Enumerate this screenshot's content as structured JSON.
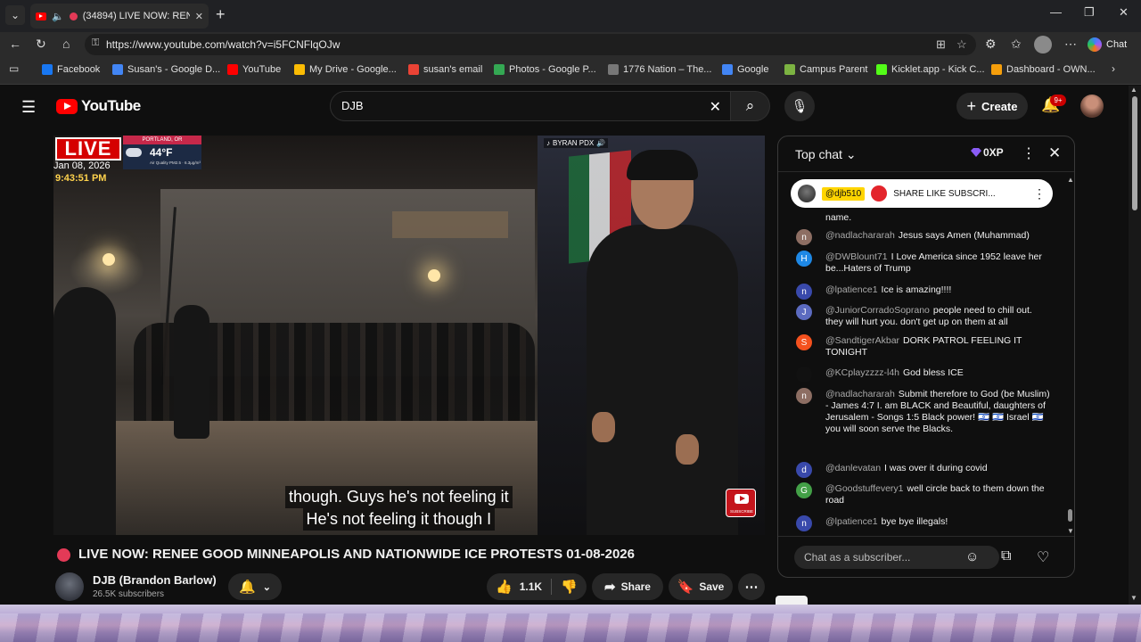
{
  "browser": {
    "tab": {
      "title": "(34894) LIVE NOW: RENEE GOOD MINNEAPOLIS",
      "close": "✕"
    },
    "new_tab": "+",
    "url": "https://www.youtube.com/watch?v=i5FCNFlqOJw",
    "chat_label": "Chat",
    "bookmarks": [
      {
        "label": "Facebook",
        "color": "#1877f2"
      },
      {
        "label": "Susan's - Google D...",
        "color": "#4285f4"
      },
      {
        "label": "YouTube",
        "color": "#ff0000"
      },
      {
        "label": "My Drive - Google...",
        "color": "#fbbc04"
      },
      {
        "label": "susan's email",
        "color": "#ea4335"
      },
      {
        "label": "Photos - Google P...",
        "color": "#34a853"
      },
      {
        "label": "1776 Nation – The...",
        "color": "#777777"
      },
      {
        "label": "Google",
        "color": "#4285f4"
      },
      {
        "label": "Campus Parent",
        "color": "#7cb342"
      },
      {
        "label": "Kicklet.app - Kick C...",
        "color": "#53fc18"
      },
      {
        "label": "Dashboard - OWN...",
        "color": "#f59e0b"
      }
    ]
  },
  "youtube": {
    "logo_text": "YouTube",
    "search_value": "DJB",
    "create_label": "Create",
    "notifications_badge": "9+"
  },
  "video": {
    "live_label": "LIVE",
    "weather_city": "PORTLAND, OR",
    "weather_temp": "44°F",
    "weather_note": "Air Quality PM2.5 · 6.3μg/m³",
    "overlay_date": "Jan 08, 2026",
    "overlay_time": "9:43:51 PM",
    "tiktok_handle": "BYRAN PDX",
    "subscribe_label": "SUBSCRIBE",
    "caption_line1": "though. Guys he's not feeling it",
    "caption_line2": "He's not feeling it though I",
    "title": "LIVE NOW: RENEE GOOD MINNEAPOLIS AND NATIONWIDE ICE PROTESTS 01-08-2026",
    "channel_name": "DJB (Brandon Barlow)",
    "subscribers": "26.5K subscribers",
    "likes": "1.1K",
    "share_label": "Share",
    "save_label": "Save"
  },
  "chat": {
    "header": "Top chat",
    "xp": "0XP",
    "pinned": {
      "handle": "@djb510",
      "text": "SHARE LIKE SUBSCRI..."
    },
    "partial_line": "name.",
    "messages": [
      {
        "initial": "n",
        "color": "#8d6e63",
        "author": "@nadlachararah",
        "text": "Jesus says Amen (Muhammad)"
      },
      {
        "initial": "H",
        "color": "#1e88e5",
        "author": "@DWBlount71",
        "text": "I Love America since 1952 leave her be...Haters of Trump"
      },
      {
        "initial": "n",
        "color": "#3949ab",
        "author": "@lpatience1",
        "text": "Ice is amazing!!!!"
      },
      {
        "initial": "J",
        "color": "#5c6bc0",
        "author": "@JuniorCorradoSoprano",
        "text": "people need to chill out. they will hurt you. don't get up on them at all"
      },
      {
        "initial": "S",
        "color": "#f4511e",
        "author": "@SandtigerAkbar",
        "text": "DORK PATROL FEELING IT TONIGHT"
      },
      {
        "initial": "",
        "color": "#111111",
        "author": "@KCplayzzzz-l4h",
        "text": "God bless ICE"
      },
      {
        "initial": "n",
        "color": "#8d6e63",
        "author": "@nadlachararah",
        "text": "Submit therefore to God (be Muslim) - James 4:7 I. am BLACK and Beautiful, daughters of Jerusalem - Songs 1:5 Black power! 🇮🇱 🇮🇱 Israel 🇮🇱 you will soon serve the Blacks."
      },
      {
        "initial": "d",
        "color": "#3949ab",
        "author": "@danlevatan",
        "text": "I was over it during covid"
      },
      {
        "initial": "G",
        "color": "#43a047",
        "author": "@Goodstuffevery1",
        "text": "well circle back to them down the road"
      },
      {
        "initial": "n",
        "color": "#3949ab",
        "author": "@lpatience1",
        "text": "bye bye illegals!"
      }
    ],
    "input_placeholder": "Chat as a subscriber..."
  }
}
